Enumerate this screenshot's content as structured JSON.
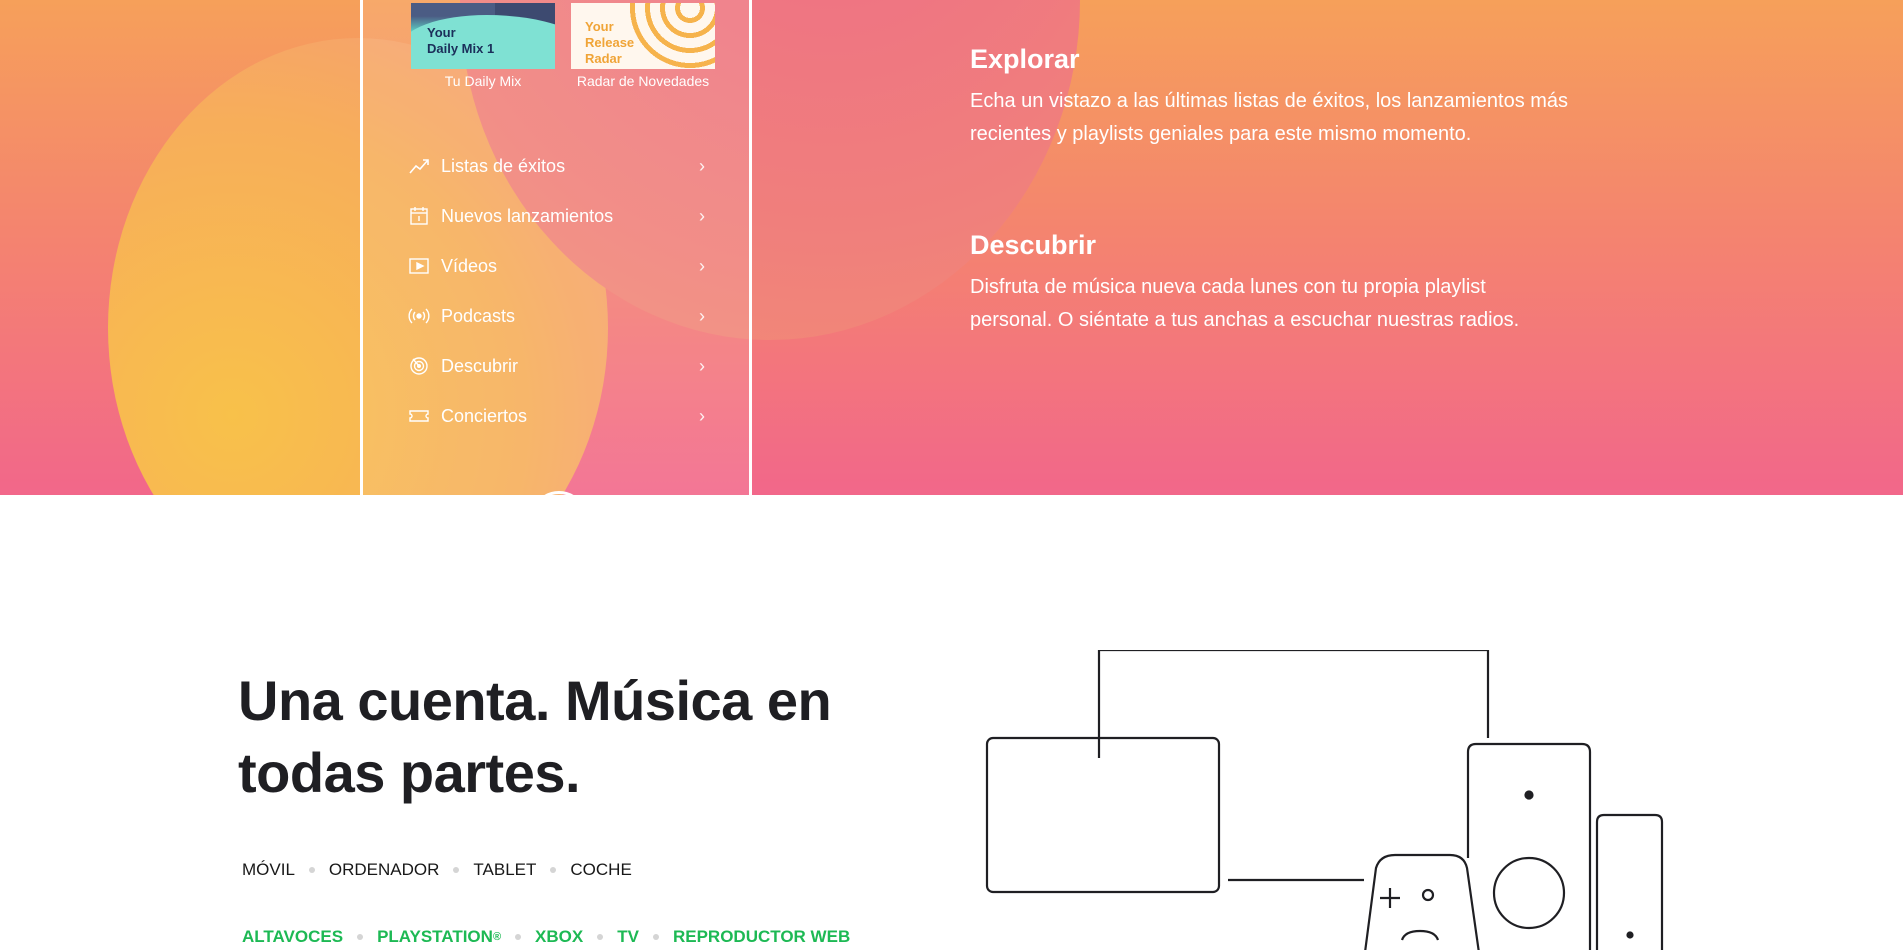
{
  "phone": {
    "covers": [
      {
        "lines": [
          "Your",
          "Daily Mix 1"
        ],
        "caption": "Tu Daily Mix",
        "icon": "daily-mix-cover"
      },
      {
        "lines": [
          "Your",
          "Release",
          "Radar"
        ],
        "caption": "Radar de Novedades",
        "icon": "release-radar-cover"
      }
    ],
    "menu": [
      {
        "label": "Listas de éxitos",
        "icon": "trending-icon"
      },
      {
        "label": "Nuevos lanzamientos",
        "icon": "calendar-icon"
      },
      {
        "label": "Vídeos",
        "icon": "video-icon"
      },
      {
        "label": "Podcasts",
        "icon": "podcast-icon"
      },
      {
        "label": "Descubrir",
        "icon": "discover-icon"
      },
      {
        "label": "Conciertos",
        "icon": "ticket-icon"
      }
    ],
    "chevron": "›"
  },
  "features": [
    {
      "title": "Explorar",
      "body": "Echa un vistazo a las últimas listas de éxitos, los lanzamientos más recientes y playlists geniales para este mismo momento."
    },
    {
      "title": "Descubrir",
      "body": "Disfruta de música nueva cada lunes con tu propia playlist personal. O siéntate a tus anchas a escuchar nuestras radios."
    }
  ],
  "section": {
    "headline": "Una cuenta. Música en todas partes.",
    "platforms": [
      "MÓVIL",
      "ORDENADOR",
      "TABLET",
      "COCHE"
    ],
    "links": [
      "ALTAVOCES",
      "PLAYSTATION",
      "XBOX",
      "TV",
      "REPRODUCTOR WEB"
    ],
    "playstation_mark": "®"
  },
  "colors": {
    "accent_green": "#1db954",
    "hero_top": "#f6a05a",
    "hero_bottom": "#f2678a",
    "heading_dark": "#1f1f23"
  }
}
